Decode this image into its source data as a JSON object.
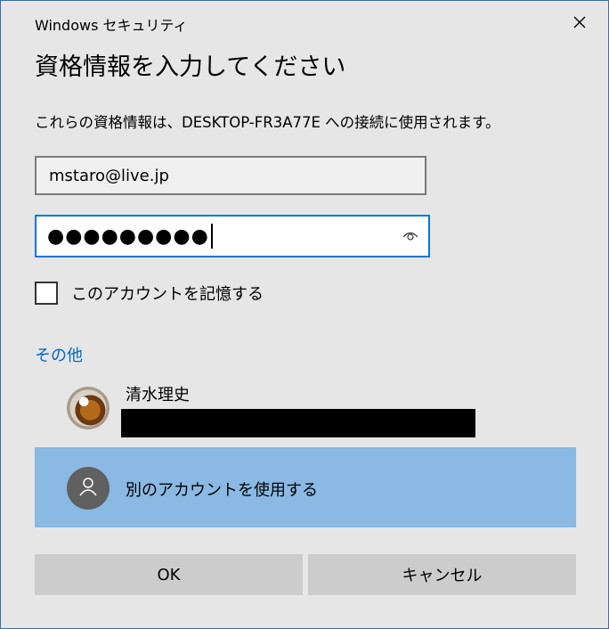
{
  "window": {
    "title": "Windows セキュリティ"
  },
  "heading": "資格情報を入力してください",
  "description": "これらの資格情報は、DESKTOP-FR3A77E への接続に使用されます。",
  "username_field": {
    "value": "mstaro@live.jp"
  },
  "password_field": {
    "masked_value": "●●●●●●●●●"
  },
  "remember": {
    "label": "このアカウントを記憶する",
    "checked": false
  },
  "more_choices": {
    "label": "その他"
  },
  "accounts": [
    {
      "name": "清水理史"
    }
  ],
  "other_account": {
    "label": "別のアカウントを使用する"
  },
  "buttons": {
    "ok": "OK",
    "cancel": "キャンセル"
  },
  "colors": {
    "background": "#e6e6e6",
    "accent": "#0078d7",
    "link": "#0067c0",
    "selected_row": "#8ab9e3",
    "button": "#cccccc"
  },
  "icons": {
    "close": "close-icon",
    "reveal_password": "eye-icon",
    "person": "person-icon"
  }
}
